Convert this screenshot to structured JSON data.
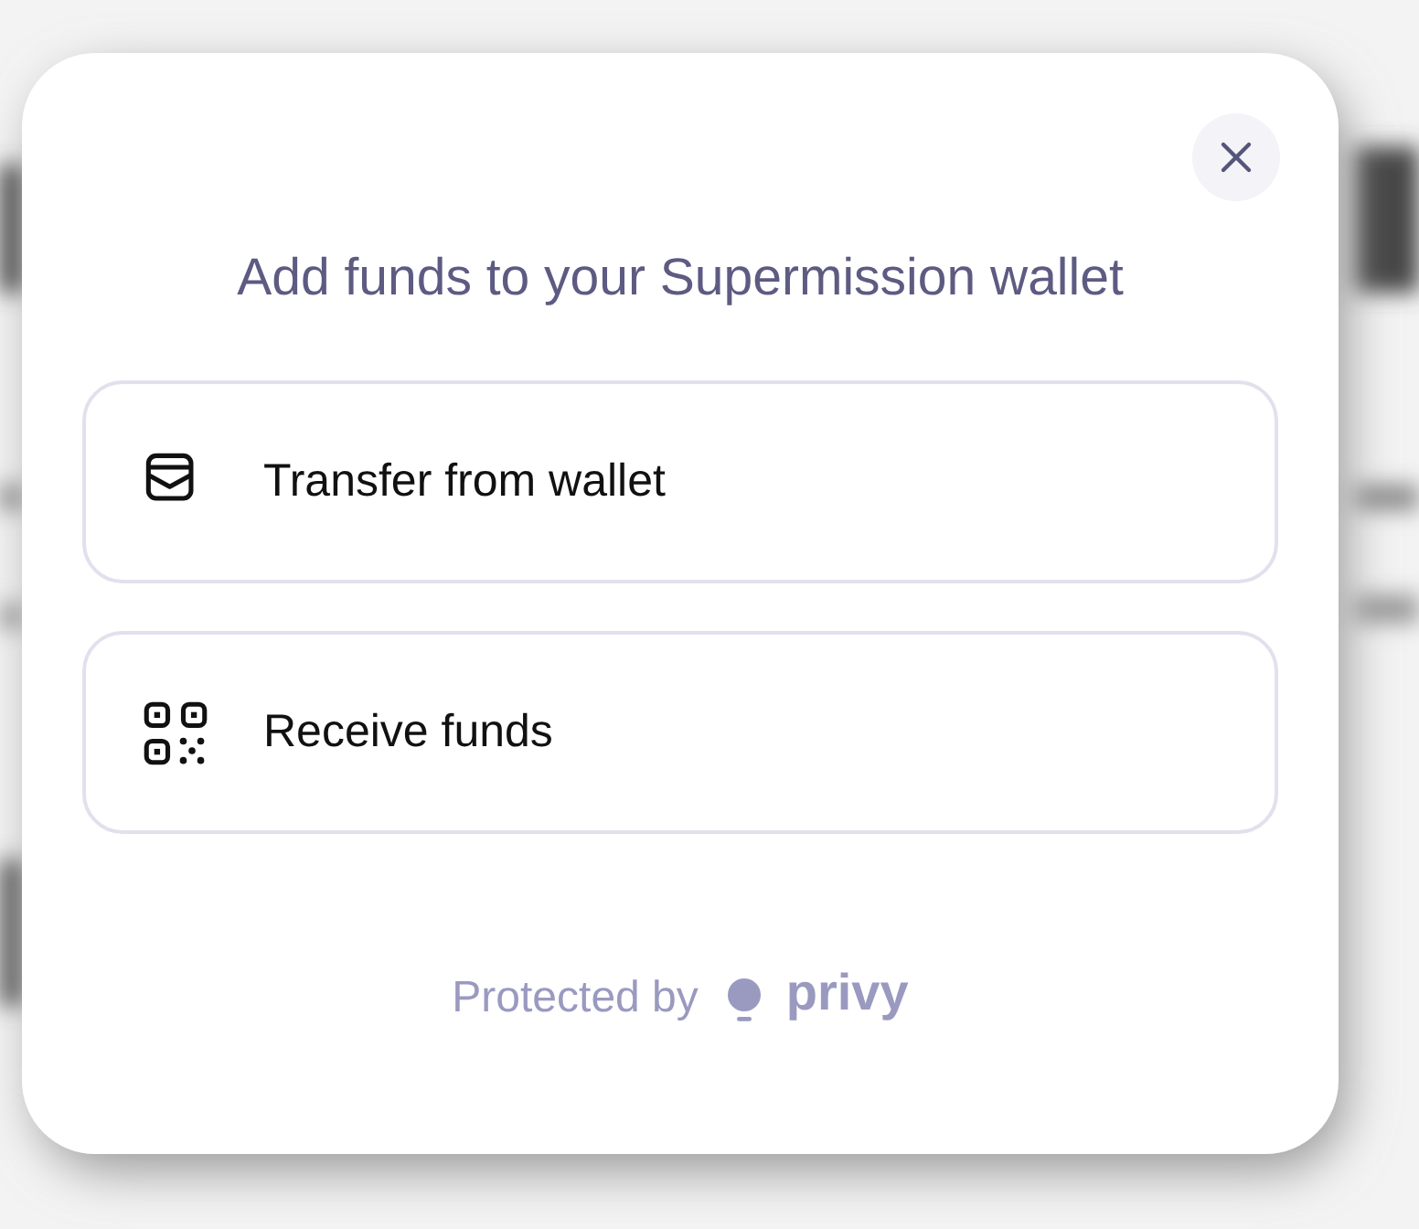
{
  "dialog": {
    "title": "Add funds to your Supermission wallet",
    "options": [
      {
        "kind": "wallet",
        "label": "Transfer from wallet"
      },
      {
        "kind": "qr",
        "label": "Receive funds"
      }
    ],
    "footer": {
      "text": "Protected by",
      "brand": "privy"
    }
  }
}
